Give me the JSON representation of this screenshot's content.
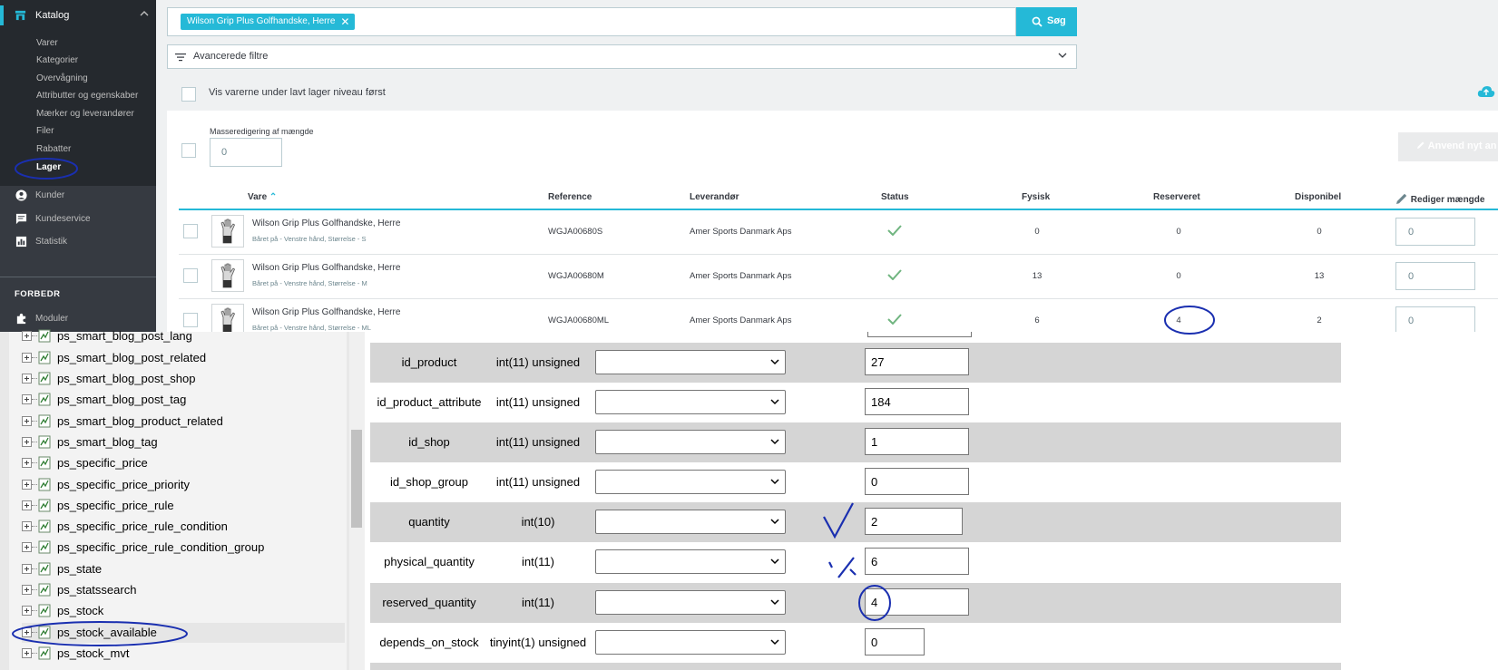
{
  "sidebar": {
    "catalog_label": "Katalog",
    "catalog_items": [
      {
        "label": "Varer"
      },
      {
        "label": "Kategorier"
      },
      {
        "label": "Overvågning"
      },
      {
        "label": "Attributter og egenskaber"
      },
      {
        "label": "Mærker og leverandører"
      },
      {
        "label": "Filer"
      },
      {
        "label": "Rabatter"
      },
      {
        "label": "Lager"
      }
    ],
    "links": [
      {
        "label": "Kunder",
        "icon": "customer-icon"
      },
      {
        "label": "Kundeservice",
        "icon": "chat-icon"
      },
      {
        "label": "Statistik",
        "icon": "chart-icon"
      }
    ],
    "section_title": "FORBEDR",
    "modules_label": "Moduler"
  },
  "search": {
    "tag": "Wilson Grip Plus Golfhandske, Herre",
    "button": "Søg"
  },
  "filters": {
    "advanced_label": "Avancerede filtre",
    "low_stock_label": "Vis varerne under lavt lager niveau først"
  },
  "bulk": {
    "label": "Masseredigering af mængde",
    "value": "0",
    "apply_label": "Anvend nyt an"
  },
  "table": {
    "headers": {
      "product": "Vare",
      "reference": "Reference",
      "supplier": "Leverandør",
      "status": "Status",
      "physical": "Fysisk",
      "reserved": "Reserveret",
      "available": "Disponibel",
      "edit_qty": "Rediger mængde"
    },
    "rows": [
      {
        "name": "Wilson Grip Plus Golfhandske, Herre",
        "attrs": "Båret på - Venstre hånd, Størrelse - S",
        "reference": "WGJA00680S",
        "supplier": "Amer Sports Danmark Aps",
        "physical": "0",
        "reserved": "0",
        "available": "0",
        "qty": "0"
      },
      {
        "name": "Wilson Grip Plus Golfhandske, Herre",
        "attrs": "Båret på - Venstre hånd, Størrelse - M",
        "reference": "WGJA00680M",
        "supplier": "Amer Sports Danmark Aps",
        "physical": "13",
        "reserved": "0",
        "available": "13",
        "qty": "0"
      },
      {
        "name": "Wilson Grip Plus Golfhandske, Herre",
        "attrs": "Båret på - Venstre hånd, Størrelse - ML",
        "reference": "WGJA00680ML",
        "supplier": "Amer Sports Danmark Aps",
        "physical": "6",
        "reserved": "4",
        "available": "2",
        "qty": "0"
      }
    ]
  },
  "tree": {
    "items": [
      {
        "label": "ps_smart_blog_post_lang"
      },
      {
        "label": "ps_smart_blog_post_related"
      },
      {
        "label": "ps_smart_blog_post_shop"
      },
      {
        "label": "ps_smart_blog_post_tag"
      },
      {
        "label": "ps_smart_blog_product_related"
      },
      {
        "label": "ps_smart_blog_tag"
      },
      {
        "label": "ps_specific_price"
      },
      {
        "label": "ps_specific_price_priority"
      },
      {
        "label": "ps_specific_price_rule"
      },
      {
        "label": "ps_specific_price_rule_condition"
      },
      {
        "label": "ps_specific_price_rule_condition_group"
      },
      {
        "label": "ps_state"
      },
      {
        "label": "ps_statssearch"
      },
      {
        "label": "ps_stock"
      },
      {
        "label": "ps_stock_available"
      },
      {
        "label": "ps_stock_mvt"
      }
    ]
  },
  "fields": [
    {
      "name": "id_product",
      "type": "int(11) unsigned",
      "value": "27"
    },
    {
      "name": "id_product_attribute",
      "type": "int(11) unsigned",
      "value": "184"
    },
    {
      "name": "id_shop",
      "type": "int(11) unsigned",
      "value": "1"
    },
    {
      "name": "id_shop_group",
      "type": "int(11) unsigned",
      "value": "0"
    },
    {
      "name": "quantity",
      "type": "int(10)",
      "value": "2"
    },
    {
      "name": "physical_quantity",
      "type": "int(11)",
      "value": "6"
    },
    {
      "name": "reserved_quantity",
      "type": "int(11)",
      "value": "4"
    },
    {
      "name": "depends_on_stock",
      "type": "tinyint(1) unsigned",
      "value": "0"
    }
  ],
  "colors": {
    "accent": "#25b9d7",
    "sidebar": "#363a41",
    "ink": "#1a2fb0"
  }
}
